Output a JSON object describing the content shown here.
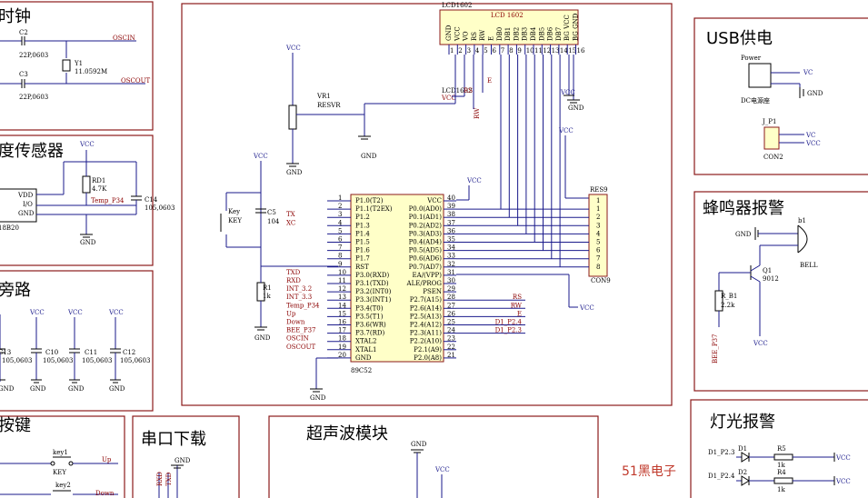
{
  "sections": {
    "clock": "时钟",
    "temp": "度传感器",
    "bypass": "旁路",
    "keys": "按键",
    "serial": "串口下载",
    "ultra": "超声波模块",
    "usb": "USB供电",
    "buzzer": "蜂鸣器报警",
    "light": "灯光报警"
  },
  "brand": "51黑电子",
  "mcu": {
    "name": "89C52",
    "left_pins": [
      "P1.0(T2)",
      "P1.1(T2EX)",
      "P1.2",
      "P1.3",
      "P1.4",
      "P1.5",
      "P1.6",
      "P1.7",
      "RST",
      "P3.0(RXD)",
      "P3.1(TXD)",
      "P3.2(INT0)",
      "P3.3(INT1)",
      "P3.4(T0)",
      "P3.5(T1)",
      "P3.6(WR)",
      "P3.7(RD)",
      "XTAL2",
      "XTAL1",
      "GND"
    ],
    "right_pins": [
      "VCC",
      "P0.0(AD0)",
      "P0.1(AD1)",
      "P0.2(AD2)",
      "P0.3(AD3)",
      "P0.4(AD4)",
      "P0.5(AD5)",
      "P0.6(AD6)",
      "P0.7(AD7)",
      "EA/(VPP)",
      "ALE/PROG",
      "PSEN",
      "P2.7(A15)",
      "P2.6(A14)",
      "P2.5(A13)",
      "P2.4(A12)",
      "P2.3(A11)",
      "P2.2(A10)",
      "P2.1(A9)",
      "P2.0(A8)"
    ],
    "left_nums": [
      "1",
      "2",
      "3",
      "4",
      "5",
      "6",
      "7",
      "8",
      "9",
      "10",
      "11",
      "12",
      "13",
      "14",
      "15",
      "16",
      "17",
      "18",
      "19",
      "20"
    ],
    "right_nums": [
      "40",
      "39",
      "38",
      "37",
      "36",
      "35",
      "34",
      "33",
      "32",
      "31",
      "30",
      "29",
      "28",
      "27",
      "26",
      "25",
      "24",
      "23",
      "22",
      "21"
    ],
    "left_nets": [
      "",
      "",
      "TX",
      "XC",
      "",
      "",
      "",
      "",
      "",
      "TXD",
      "RXD",
      "INT_3.2",
      "INT_3.3",
      "Temp_P34",
      "Up",
      "Down",
      "BEE_P37",
      "OSCIN",
      "OSCOUT",
      ""
    ],
    "right_nets": [
      "",
      "",
      "",
      "",
      "",
      "",
      "",
      "",
      "",
      "",
      "",
      "",
      "RS",
      "RW",
      "E",
      "D1_P2.4",
      "D1_P2.3",
      "",
      "",
      ""
    ]
  },
  "lcd": {
    "ref": "LCD1602",
    "name": "LCD 1602",
    "pins": [
      "GND",
      "VCC",
      "VO",
      "RS",
      "RW",
      "E",
      "DB0",
      "DB1",
      "DB2",
      "DB3",
      "DB4",
      "DB5",
      "DB6",
      "DB7",
      "BG VCC",
      "BG GND"
    ],
    "nums": [
      "1",
      "2",
      "3",
      "4",
      "5",
      "6",
      "7",
      "8",
      "9",
      "10",
      "11",
      "12",
      "13",
      "14",
      "15",
      "16"
    ],
    "label2": "LCD1602",
    "label3": "VCC",
    "rs": "RS",
    "rw": "RW",
    "e": "E"
  },
  "labels": {
    "vcc": "VCC",
    "gnd": "GND",
    "c2": "C2",
    "c2v": "22P,0603",
    "c3": "C3",
    "c3v": "22P,0603",
    "y1": "Y1",
    "y1v": "11.0592M",
    "oscin": "OSCIN",
    "oscout": "OSCOUT",
    "rd1": "RD1",
    "rd1v": "4.7K",
    "vdd": "VDD",
    "io": "I/O",
    "gndp": "GND",
    "ds": "18B20",
    "temp": "Temp_P34",
    "c14": "C14",
    "c14v": "105,0603",
    "c13": "C13",
    "c10": "C10",
    "c11": "C11",
    "c12": "C12",
    "cv": "105,0603",
    "vr1": "VR1",
    "resvr": "RESVR",
    "key": "Key",
    "keyl": "KEY",
    "c5": "C5",
    "c5v": "104",
    "r1": "R1",
    "r1v": "1k",
    "res9": "RES9",
    "con9": "CON9",
    "power": "Power",
    "dc": "DC电源座",
    "jp1": "J_P1",
    "con2": "CON2",
    "b1": "b1",
    "bell": "BELL",
    "q1": "Q1",
    "q1v": "9012",
    "rb1": "R_B1",
    "rb1v": "2.2k",
    "bee": "BEE_P37",
    "key1": "key1",
    "key2": "key2",
    "up": "Up",
    "down": "Down",
    "rxd": "RXD",
    "txd": "TXD",
    "d1": "D1",
    "d2": "D2",
    "r5": "R5",
    "r4": "R4",
    "rk": "1k",
    "d1p23": "D1_P2.3",
    "d1p24": "D1_P2.4",
    "vc": "VC"
  },
  "colors": {
    "border": "#8b1a1a",
    "wire": "#1a1a8b",
    "netlabel": "#8b0000",
    "brand": "#c0392b"
  }
}
